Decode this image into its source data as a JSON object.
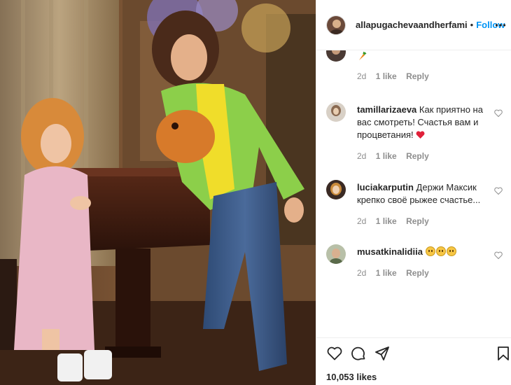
{
  "header": {
    "username": "allapugachevaandherfami",
    "separator": "•",
    "follow_label": "Follow",
    "more_icon": "more-horizontal-icon"
  },
  "comments": [
    {
      "username": "",
      "text": "🥕",
      "age": "2d",
      "likes": "1 like",
      "reply": "Reply"
    },
    {
      "username": "tamillarizaeva",
      "text": "Как приятно на вас смотреть! Счастья вам и процветания!",
      "age": "2d",
      "likes": "1 like",
      "reply": "Reply"
    },
    {
      "username": "luciakarputin",
      "text": "Держи Максик крепко своё рыжее счастье...",
      "age": "2d",
      "likes": "1 like",
      "reply": "Reply"
    },
    {
      "username": "musatkinalidiia",
      "text": "",
      "age": "2d",
      "likes": "1 like",
      "reply": "Reply"
    }
  ],
  "load_more_icon": "plus-circle-icon",
  "actions": {
    "like_icon": "heart-outline-icon",
    "comment_icon": "comment-icon",
    "share_icon": "paper-plane-icon",
    "save_icon": "bookmark-icon"
  },
  "likes_count": "10,053 likes",
  "colors": {
    "link_blue": "#0095f6",
    "meta_gray": "#8e8e8e",
    "border": "#efefef"
  }
}
